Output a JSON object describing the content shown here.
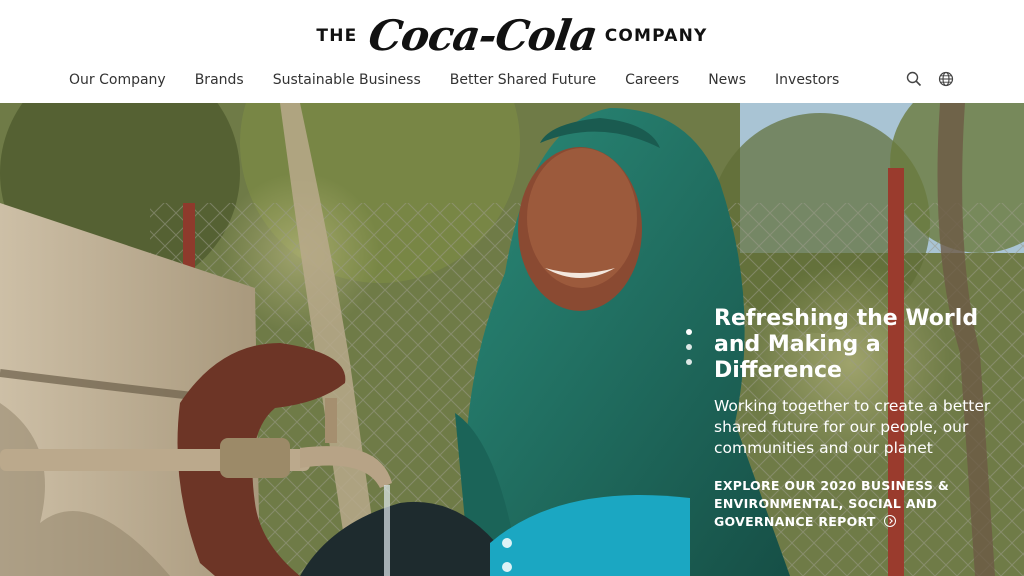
{
  "header": {
    "brand_prefix": "THE",
    "brand_logo": "Coca-Cola",
    "brand_suffix": "COMPANY",
    "nav": [
      {
        "label": "Our Company"
      },
      {
        "label": "Brands"
      },
      {
        "label": "Sustainable Business"
      },
      {
        "label": "Better Shared Future"
      },
      {
        "label": "Careers"
      },
      {
        "label": "News"
      },
      {
        "label": "Investors"
      }
    ],
    "icons": [
      "search-icon",
      "globe-icon"
    ]
  },
  "hero": {
    "title": "Refreshing the World and Making a Difference",
    "subtitle": "Working together to create a better shared future for our people, our communities and our planet",
    "cta": "EXPLORE OUR 2020 BUSINESS & ENVIRONMENTAL, SOCIAL AND GOVERNANCE REPORT",
    "cta_icon": "arrow-circle-right-icon"
  },
  "colors": {
    "text": "#1a1a1a",
    "hero_text": "#ffffff",
    "scarf": "#1f6f62",
    "sky": "#b9d7ea"
  }
}
